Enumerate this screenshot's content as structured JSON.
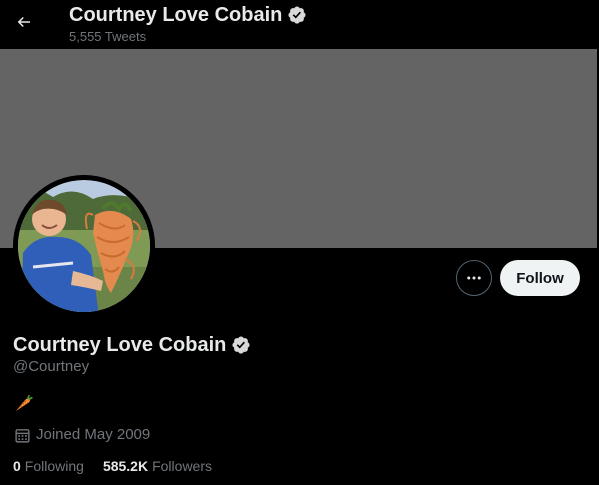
{
  "header": {
    "title": "Courtney Love Cobain",
    "subtitle": "5,555 Tweets",
    "back_icon": "arrow-left-icon"
  },
  "banner": {
    "color": "#646464"
  },
  "actions": {
    "more_icon": "ellipsis-icon",
    "follow_label": "Follow"
  },
  "profile": {
    "name": "Courtney Love Cobain",
    "verified": true,
    "handle": "@Courtney",
    "bio_emoji": "carrot-emoji",
    "joined_icon": "calendar-icon",
    "joined": "Joined May 2009"
  },
  "stats": {
    "following_count": "0",
    "following_label": "Following",
    "followers_count": "585.2K",
    "followers_label": "Followers"
  },
  "colors": {
    "background": "#000000",
    "primary_text": "#e7e9ea",
    "secondary_text": "#71767b",
    "follow_button_bg": "#eff3f4",
    "verified_badge": "#d9d9d9",
    "banner": "#646464"
  }
}
